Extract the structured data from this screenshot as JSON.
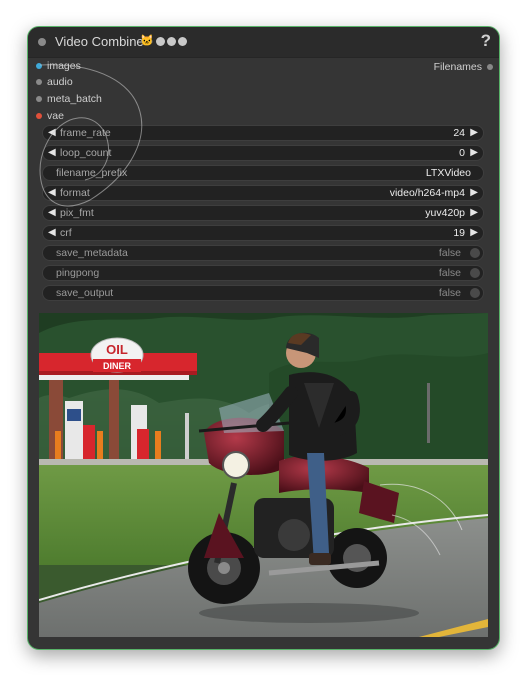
{
  "node": {
    "title": "Video Combine",
    "title_icon": "cat-face-icon",
    "badges": [
      "badge-1",
      "badge-2",
      "badge-3"
    ],
    "help": "?",
    "border_color": "#58b368"
  },
  "inputs": [
    {
      "label": "images",
      "color": "#3fa9d8"
    },
    {
      "label": "audio",
      "color": "#8a8a8a"
    },
    {
      "label": "meta_batch",
      "color": "#8a8a8a"
    },
    {
      "label": "vae",
      "color": "#e0503a"
    }
  ],
  "outputs": [
    {
      "label": "Filenames"
    }
  ],
  "widgets": {
    "frame_rate": {
      "label": "frame_rate",
      "value": "24"
    },
    "loop_count": {
      "label": "loop_count",
      "value": "0"
    },
    "filename_prefix": {
      "label": "filename_prefix",
      "value": "LTXVideo"
    },
    "format": {
      "label": "format",
      "value": "video/h264-mp4"
    },
    "pix_fmt": {
      "label": "pix_fmt",
      "value": "yuv420p"
    },
    "crf": {
      "label": "crf",
      "value": "19"
    },
    "save_metadata": {
      "label": "save_metadata",
      "value": "false"
    },
    "pingpong": {
      "label": "pingpong",
      "value": "false"
    },
    "save_output": {
      "label": "save_output",
      "value": "false"
    }
  },
  "preview": {
    "sign_line1": "OIL",
    "sign_line2": "DINER",
    "description_icon": "video-preview-image"
  }
}
